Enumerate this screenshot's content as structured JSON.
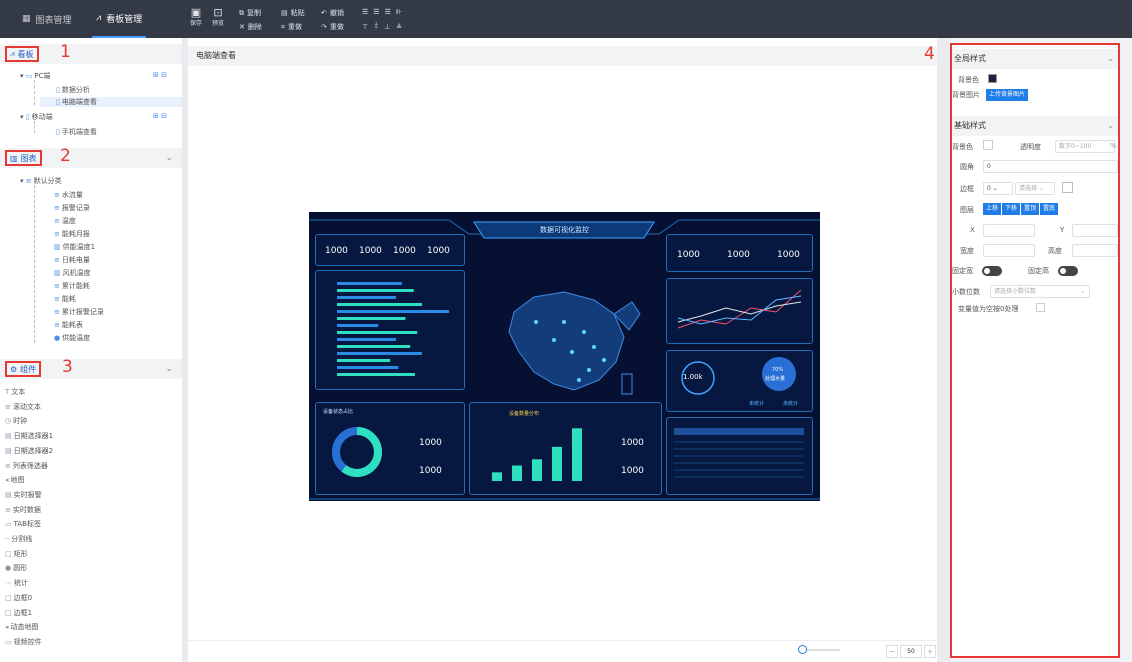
{
  "topbar": {
    "tabs": [
      {
        "label": "图表管理",
        "icon": "grid-icon"
      },
      {
        "label": "看板管理",
        "icon": "dashboard-icon"
      }
    ],
    "tools_big": [
      {
        "label": "保存",
        "glyph": "💾"
      },
      {
        "label": "预览",
        "glyph": "🔍"
      }
    ],
    "tools_small": {
      "copy": "复制",
      "paste": "粘贴",
      "undo": "撤销",
      "delete": "删除",
      "clear": "重做",
      "redo": "重做"
    }
  },
  "left": {
    "board_section": {
      "title": "看板",
      "num": "1"
    },
    "pc_group": "PC端",
    "pc_items": [
      "数据分析",
      "电脑端查看"
    ],
    "mobile_group": "移动端",
    "mobile_items": [
      "手机端查看"
    ],
    "chart_section": {
      "title": "图表",
      "num": "2"
    },
    "chart_group": "默认分类",
    "chart_items": [
      "水流量",
      "报警记录",
      "温度",
      "能耗月报",
      "供能温度1",
      "日耗电量",
      "风机温度",
      "累计能耗",
      "能耗",
      "累计报警记录",
      "能耗表",
      "供能温度"
    ],
    "comp_section": {
      "title": "组件",
      "num": "3"
    },
    "comp_items": [
      "文本",
      "滚动文本",
      "时钟",
      "日期选择器1",
      "日期选择器2",
      "列表筛选器",
      "地图",
      "实时报警",
      "实时数据",
      "TAB标签",
      "分割线",
      "矩形",
      "圆形",
      "统计",
      "边框0",
      "边框1",
      "动态地图",
      "视频控件"
    ]
  },
  "center": {
    "title": "电脑端查看",
    "zoom": "50",
    "dashboard": {
      "title": "数据可视化监控",
      "kpi_values": [
        "1000",
        "1000",
        "1000",
        "1000"
      ],
      "right_kpis": [
        "1000",
        "1000",
        "1000"
      ],
      "gauge": "1.00k",
      "water_pct": "70%",
      "water_label": "处理水量",
      "unstat": [
        "未统计",
        "未统计"
      ],
      "donut_title": "设备状态占比",
      "bar_title": "设备数量分布",
      "donut_kpis": [
        "1000",
        "1000"
      ],
      "bar_kpis": [
        "1000",
        "1000"
      ]
    }
  },
  "right": {
    "num": "4",
    "global_title": "全局样式",
    "bg_color_label": "背景色",
    "bg_image_label": "背景图片",
    "upload_btn": "上传背景图片",
    "basic_title": "基础样式",
    "bg_color2": "背景色",
    "opacity_label": "透明度",
    "opacity_ph": "数字0~100",
    "percent": "%",
    "radius_label": "圆角",
    "radius_val": "0",
    "border_label": "边框",
    "border_val": "0",
    "border_style_ph": "请选择",
    "layer_label": "图层",
    "layer_btns": [
      "上移",
      "下移",
      "置顶",
      "置底"
    ],
    "x_label": "X",
    "y_label": "Y",
    "width_label": "宽度",
    "height_label": "高度",
    "fixed_w": "固定宽",
    "fixed_h": "固定高",
    "decimals_label": "小数位数",
    "decimals_ph": "请选择小数位数",
    "null_zero_label": "变量值为空按0处理"
  }
}
